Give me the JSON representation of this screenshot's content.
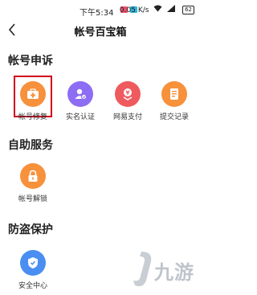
{
  "status_bar": {
    "time": "下午5:34",
    "battery": "62",
    "network_speed": "0.05 K/s"
  },
  "header": {
    "title": "帐号百宝箱",
    "back_icon": "chevron-left-icon"
  },
  "sections": [
    {
      "title": "帐号申诉",
      "items": [
        {
          "label": "帐号修复",
          "icon": "medkit-icon",
          "color": "#f7913c",
          "highlighted": true
        },
        {
          "label": "实名认证",
          "icon": "user-verified-icon",
          "color": "#8c6df3"
        },
        {
          "label": "网易支付",
          "icon": "payment-icon",
          "color": "#ef5a5f"
        },
        {
          "label": "提交记录",
          "icon": "record-icon",
          "color": "#f7913c"
        }
      ]
    },
    {
      "title": "自助服务",
      "items": [
        {
          "label": "帐号解锁",
          "icon": "lock-icon",
          "color": "#f7913c"
        }
      ]
    },
    {
      "title": "防盗保护",
      "items": [
        {
          "label": "安全中心",
          "icon": "shield-icon",
          "color": "#4a8ef2"
        }
      ]
    }
  ],
  "watermark": {
    "text": "九游"
  },
  "colors": {
    "highlight_border": "#d0021b"
  }
}
